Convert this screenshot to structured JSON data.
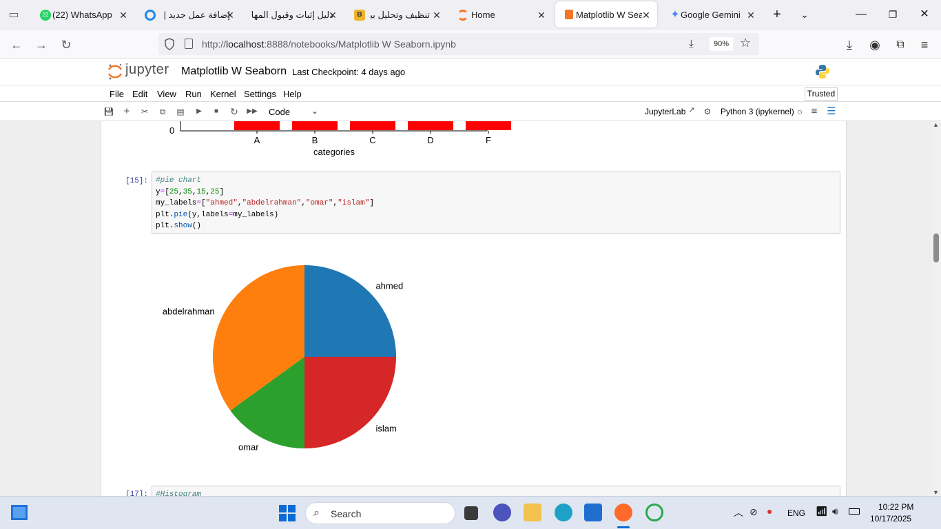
{
  "browser": {
    "tabs": [
      {
        "label": "(22) WhatsApp",
        "badge": "22",
        "icon": "whatsapp-icon"
      },
      {
        "label": "إضافة عمل جديد |",
        "icon": "khamsat-icon"
      },
      {
        "label": "دليل إثبات وقبول المها",
        "icon": "page-icon"
      },
      {
        "label": "تنظيف وتحليل بيان",
        "icon": "b-icon"
      },
      {
        "label": "Home",
        "icon": "jupyter-icon"
      },
      {
        "label": "Matplotlib W Seal",
        "icon": "notebook-icon",
        "active": true
      },
      {
        "label": "Google Gemini",
        "icon": "gemini-icon"
      }
    ],
    "url_prefix": "http://",
    "url_host": "localhost",
    "url_rest": ":8888/notebooks/Matplotlib W Seaborn.ipynb",
    "zoom": "90%"
  },
  "jupyter": {
    "logo_text": "jupyter",
    "title": "Matplotlib W Seaborn",
    "checkpoint": "Last Checkpoint: 4 days ago",
    "menu": [
      "File",
      "Edit",
      "View",
      "Run",
      "Kernel",
      "Settings",
      "Help"
    ],
    "trusted": "Trusted",
    "cell_type": "Code",
    "jupyterlab_link": "JupyterLab",
    "kernel": "Python 3 (ipykernel)"
  },
  "notebook": {
    "prev_output": {
      "y_tick": "0",
      "x_ticks": [
        "A",
        "B",
        "C",
        "D",
        "F"
      ],
      "xlabel": "categories",
      "bar_color": "#ff0000"
    },
    "cell15": {
      "prompt": "[15]:",
      "code": [
        "#pie chart",
        "y=[25,35,15,25]",
        "my_labels=[\"ahmed\",\"abdelrahman\",\"omar\",\"islam\"]",
        "plt.pie(y,labels=my_labels)",
        "plt.show()"
      ]
    },
    "next_cell": {
      "prompt": "[17]:",
      "code": "#Histogram"
    }
  },
  "chart_data": {
    "type": "pie",
    "categories": [
      "ahmed",
      "abdelrahman",
      "omar",
      "islam"
    ],
    "values": [
      25,
      35,
      15,
      25
    ],
    "colors": [
      "#1f77b4",
      "#ff7f0e",
      "#2ca02c",
      "#d62728"
    ],
    "start_angle_deg": 0,
    "direction": "counterclockwise"
  },
  "taskbar": {
    "search": "Search",
    "lang": "ENG",
    "time": "10:22 PM",
    "date": "10/17/2025"
  }
}
